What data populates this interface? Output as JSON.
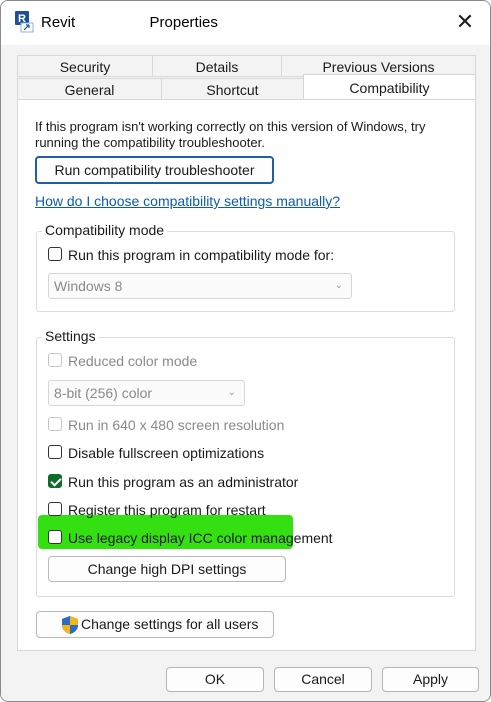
{
  "window": {
    "title_prefix": "Revit",
    "title_suffix": "Properties",
    "close_glyph": "✕"
  },
  "tabs": {
    "row1": [
      "Security",
      "Details",
      "Previous Versions"
    ],
    "row2": [
      "General",
      "Shortcut",
      "Compatibility"
    ],
    "active": "Compatibility"
  },
  "intro_text": "If this program isn't working correctly on this version of Windows, try running the compatibility troubleshooter.",
  "troubleshooter_button": "Run compatibility troubleshooter",
  "help_link": "How do I choose compatibility settings manually?",
  "compat_mode": {
    "group_title": "Compatibility mode",
    "checkbox_label": "Run this program in compatibility mode for:",
    "checked": false,
    "os_select_value": "Windows 8"
  },
  "settings": {
    "group_title": "Settings",
    "reduced_color": {
      "label": "Reduced color mode",
      "checked": false,
      "disabled": true
    },
    "color_select_value": "8-bit (256) color",
    "res_640": {
      "label": "Run in 640 x 480 screen resolution",
      "checked": false,
      "disabled": true
    },
    "disable_fullscreen": {
      "label": "Disable fullscreen optimizations",
      "checked": false
    },
    "run_admin": {
      "label": "Run this program as an administrator",
      "checked": true
    },
    "register_restart": {
      "label": "Register this program for restart",
      "checked": false
    },
    "legacy_icc": {
      "label": "Use legacy display ICC color management",
      "checked": false
    },
    "dpi_button": "Change high DPI settings"
  },
  "all_users_button": "Change settings for all users",
  "footer": {
    "ok": "OK",
    "cancel": "Cancel",
    "apply": "Apply"
  },
  "colors": {
    "highlight": "#35e012",
    "link": "#0b5cad",
    "check_fill": "#0f6b2a"
  }
}
